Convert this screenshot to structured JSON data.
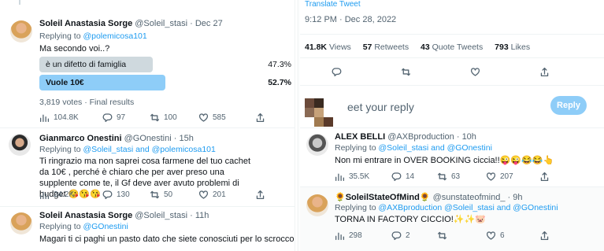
{
  "left": {
    "tweet1": {
      "name": "Soleil Anastasia Sorge",
      "handle": "@Soleil_stasi",
      "date": "· Dec 27",
      "replying_prefix": "Replying to ",
      "replying_to": "@polemicosa101",
      "text": "Ma secondo voi..?",
      "poll": [
        {
          "label": "è un difetto di famiglia",
          "percent_label": "47.3%",
          "percent": 47.3,
          "winner": false
        },
        {
          "label": "Vuole 10€",
          "percent_label": "52.7%",
          "percent": 52.7,
          "winner": true
        }
      ],
      "poll_footer": "3,819 votes · Final results",
      "views": "104.8K",
      "replies": "97",
      "retweets": "100",
      "likes": "585"
    },
    "tweet2": {
      "name": "Gianmarco Onestini",
      "handle": "@GOnestini",
      "date": "· 15h",
      "replying_prefix": "Replying to ",
      "replying_to": "@Soleil_stasi and @polemicosa101",
      "text": "Ti ringrazio ma non saprei cosa farmene del tuo cachet da 10€ , perché è chiaro che per aver preso una supplente come te, il Gf deve aver avuto problemi di budget 😘😘😘",
      "views": "24.2K",
      "replies": "130",
      "retweets": "50",
      "likes": "201"
    },
    "tweet3": {
      "name": "Soleil Anastasia Sorge",
      "handle": "@Soleil_stasi",
      "date": "· 11h",
      "replying_prefix": "Replying to ",
      "replying_to": "@GOnestini",
      "text": "Magari ti ci paghi un pasto dato che siete conosciuti per lo scrocco😌"
    }
  },
  "right": {
    "translate": "Translate Tweet",
    "timestamp": "9:12 PM · Dec 28, 2022",
    "stats": {
      "views_num": "41.8K",
      "views_label": "Views",
      "retweets_num": "57",
      "retweets_label": "Retweets",
      "quotes_num": "43",
      "quotes_label": "Quote Tweets",
      "likes_num": "793",
      "likes_label": "Likes"
    },
    "reply_box": {
      "placeholder": "eet your reply",
      "button": "Reply"
    },
    "tweet4": {
      "name": "ALEX BELLI",
      "handle": "@AXBproduction",
      "date": "· 10h",
      "replying_prefix": "Replying to ",
      "replying_to": "@Soleil_stasi and @GOnestini",
      "text": "Non mi entrare in OVER BOOKING ciccia!!😜😜😂😂👆",
      "views": "35.5K",
      "replies": "14",
      "retweets": "63",
      "likes": "207"
    },
    "tweet5": {
      "name": "🌻SoleilStateOfMind🌻",
      "handle": "@sunstateofmind_",
      "date": "· 9h",
      "replying_prefix": "Replying to ",
      "replying_to": "@AXBproduction @Soleil_stasi and @GOnestini",
      "text": "TORNA IN FACTORY CICCIO!✨✨🐷",
      "views": "298",
      "replies": "2",
      "likes": "6"
    }
  },
  "colors": {
    "accent": "#1d9bf0",
    "poll_winner": "#8ecdf8",
    "poll_other": "#cfd9de"
  }
}
